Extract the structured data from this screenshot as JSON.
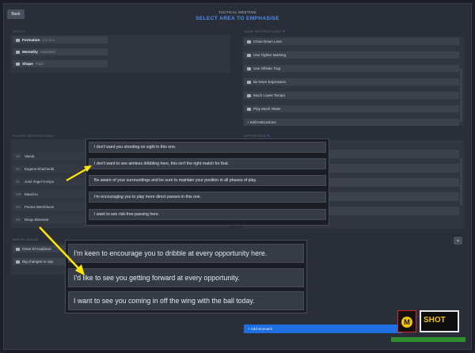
{
  "header": {
    "back_label": "Back",
    "subtitle": "TACTICAL MEETING",
    "title": "SELECT AREA TO EMPHASISE"
  },
  "tactic": {
    "label": "TACTIC",
    "items": [
      {
        "name": "Formation",
        "value": "4-1-4-1"
      },
      {
        "name": "Mentality",
        "value": "Standard"
      },
      {
        "name": "Shape",
        "value": "Fluid"
      }
    ]
  },
  "team_instructions": {
    "label": "TEAM INSTRUCTIONS",
    "items": [
      "Close Down Less",
      "Use Tighter Marking",
      "Use Offside Trap",
      "Be More Expressive",
      "Much Lower Tempo",
      "Play Much Wider"
    ],
    "edit_label": "+ Edit Instructions"
  },
  "player_instructions": {
    "label": "PLAYER INSTRUCTIONS",
    "players": [
      {
        "pos": "DC",
        "name": "Varela"
      },
      {
        "pos": "DC",
        "name": "Eugene Khacheridi"
      },
      {
        "pos": "DL",
        "name": "José Ángel Crespo"
      },
      {
        "pos": "MR",
        "name": "Maurício"
      },
      {
        "pos": "MC",
        "name": "Pontus Wernbloom"
      },
      {
        "pos": "ML",
        "name": "Diego Biseswar"
      }
    ]
  },
  "opposition": {
    "label": "OPPOSITION"
  },
  "match_squad": {
    "label": "MATCH SQUAD",
    "items": [
      "Omar El Kaddouri",
      "Big changes to squ"
    ]
  },
  "add_scenario_label": "+ Add Scenario",
  "popup_top": {
    "options": [
      "I don't want you shooting on sight in this one.",
      "I don't want to see aimless dribbling here, this isn't the right match for that.",
      "Be aware of your surroundings and be sure to maintain your position in all phases of play.",
      "I'm encouraging you to play more direct passes in this one.",
      "I want to see risk-free passing here."
    ]
  },
  "popup_bottom": {
    "options": [
      "I'm keen to encourage you to dribble at every opportunity here.",
      "I'd like to see you getting forward at every opportunity.",
      "I want to see you coming in off the wing with the ball today."
    ]
  },
  "watermark": {
    "left_text": "M",
    "right_text": "SHOT"
  },
  "colors": {
    "accent": "#1f6fe0",
    "highlight": "#4d8ff2",
    "arrow": "#ffe600"
  }
}
